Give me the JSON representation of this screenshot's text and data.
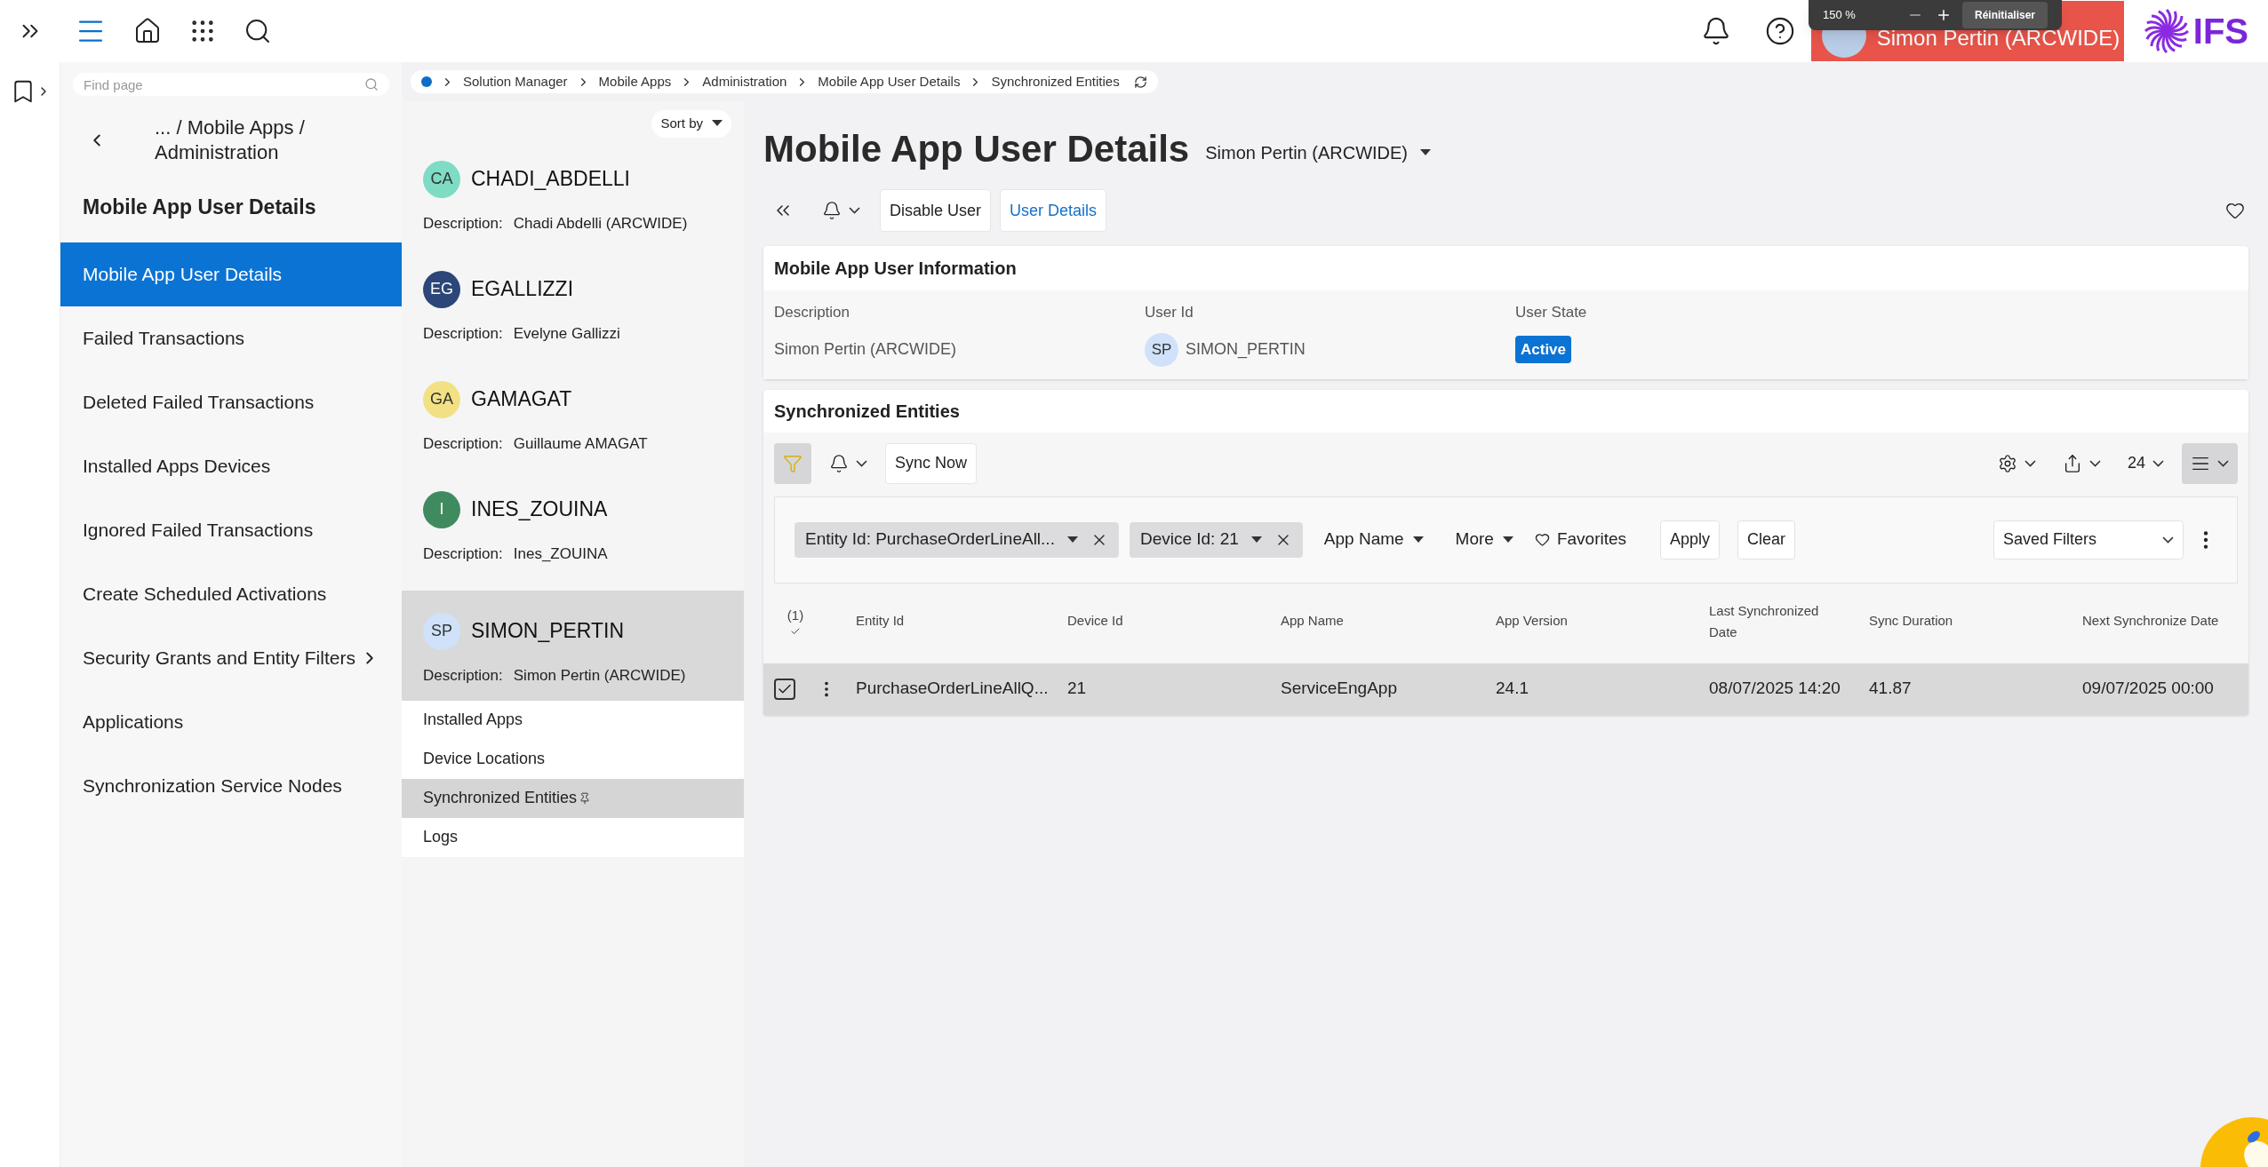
{
  "zoom_popup": {
    "value": "150 %",
    "reset": "Réinitialiser"
  },
  "user_badge": "Simon Pertin (ARCWIDE)",
  "logo": "IFS",
  "find_page": {
    "placeholder": "Find page"
  },
  "nav": {
    "path": "... / Mobile Apps / Administration",
    "heading": "Mobile App User Details",
    "items": [
      {
        "label": "Mobile App User Details",
        "selected": true,
        "has_children": false
      },
      {
        "label": "Failed Transactions",
        "selected": false,
        "has_children": false
      },
      {
        "label": "Deleted Failed Transactions",
        "selected": false,
        "has_children": false
      },
      {
        "label": "Installed Apps Devices",
        "selected": false,
        "has_children": false
      },
      {
        "label": "Ignored Failed Transactions",
        "selected": false,
        "has_children": false
      },
      {
        "label": "Create Scheduled Activations",
        "selected": false,
        "has_children": false
      },
      {
        "label": "Security Grants and Entity Filters",
        "selected": false,
        "has_children": true
      },
      {
        "label": "Applications",
        "selected": false,
        "has_children": false
      },
      {
        "label": "Synchronization Service Nodes",
        "selected": false,
        "has_children": false
      }
    ]
  },
  "breadcrumb": [
    "Solution Manager",
    "Mobile Apps",
    "Administration",
    "Mobile App User Details",
    "Synchronized Entities"
  ],
  "sort": "Sort by",
  "users": [
    {
      "initials": "CA",
      "color": "#7ddcc3",
      "name": "CHADI_ABDELLI",
      "description_label": "Description:",
      "description": "Chadi Abdelli (ARCWIDE)",
      "selected": false
    },
    {
      "initials": "EG",
      "color": "#2b4677",
      "name": "EGALLIZZI",
      "description_label": "Description:",
      "description": "Evelyne Gallizzi",
      "selected": false
    },
    {
      "initials": "GA",
      "color": "#f2e184",
      "name": "GAMAGAT",
      "description_label": "Description:",
      "description": "Guillaume AMAGAT",
      "selected": false
    },
    {
      "initials": "I",
      "color": "#3f8b5f",
      "name": "INES_ZOUINA",
      "description_label": "Description:",
      "description": "Ines_ZOUINA",
      "selected": false
    },
    {
      "initials": "SP",
      "color": "#cfe2fa",
      "name": "SIMON_PERTIN",
      "description_label": "Description:",
      "description": "Simon Pertin (ARCWIDE)",
      "selected": true
    }
  ],
  "user_pages": [
    {
      "label": "Installed Apps",
      "selected": false,
      "pinned": false
    },
    {
      "label": "Device Locations",
      "selected": false,
      "pinned": false
    },
    {
      "label": "Synchronized Entities",
      "selected": true,
      "pinned": true
    },
    {
      "label": "Logs",
      "selected": false,
      "pinned": false
    }
  ],
  "page": {
    "title": "Mobile App User Details",
    "subtitle": "Simon Pertin (ARCWIDE)",
    "buttons": [
      {
        "label": "Disable User",
        "kind": "plain"
      },
      {
        "label": "User Details",
        "kind": "link"
      }
    ]
  },
  "info": {
    "title": "Mobile App User Information",
    "fields": [
      {
        "label": "Description",
        "value": "Simon Pertin (ARCWIDE)",
        "kind": "text"
      },
      {
        "label": "User Id",
        "value": "SIMON_PERTIN",
        "initials": "SP",
        "color": "#cfe2fa",
        "kind": "avatar"
      },
      {
        "label": "User State",
        "value": "Active",
        "kind": "badge"
      }
    ]
  },
  "entities": {
    "title": "Synchronized Entities",
    "filter_active": true,
    "sync_button": "Sync Now",
    "page_size": "24",
    "chips": [
      {
        "label": "Entity Id: PurchaseOrderLineAll..."
      },
      {
        "label": "Device Id: 21"
      }
    ],
    "filter_menus": [
      "App Name",
      "More"
    ],
    "favorites": "Favorites",
    "apply": "Apply",
    "clear": "Clear",
    "saved_filters": "Saved Filters",
    "selected_count": "(1)",
    "columns": [
      "Entity Id",
      "Device Id",
      "App Name",
      "App Version",
      "Last Synchronized Date",
      "Sync Duration",
      "Next Synchronize Date"
    ],
    "rows": [
      {
        "checked": true,
        "cells": [
          "PurchaseOrderLineAllQ...",
          "21",
          "ServiceEngApp",
          "24.1",
          "08/07/2025 14:20",
          "41.87",
          "09/07/2025 00:00"
        ]
      }
    ]
  }
}
